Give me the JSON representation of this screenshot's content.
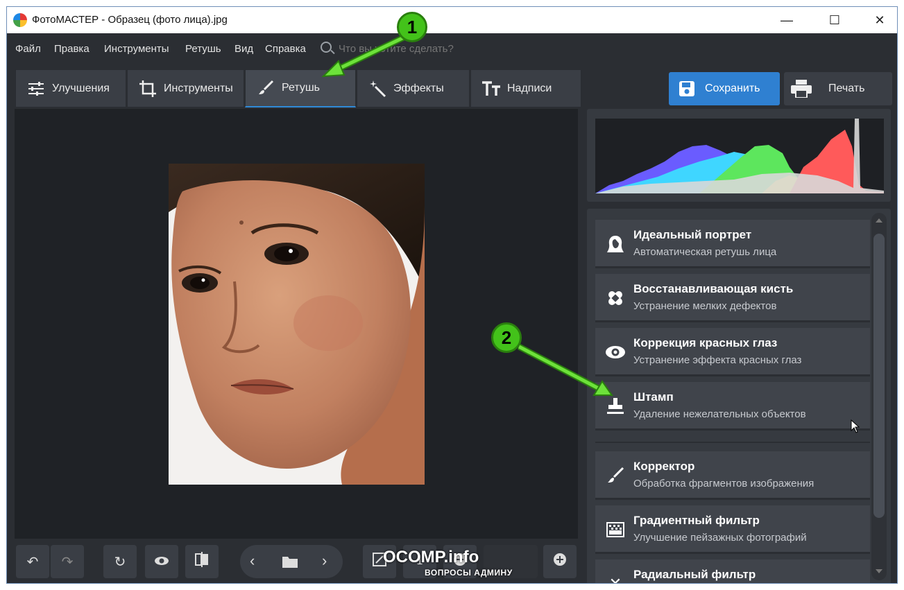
{
  "window": {
    "title": "ФотоМАСТЕР - Образец (фото лица).jpg",
    "minimize": "—",
    "maximize": "☐",
    "close": "✕"
  },
  "menu": {
    "items": [
      "Файл",
      "Правка",
      "Инструменты",
      "Ретушь",
      "Вид",
      "Справка"
    ],
    "search_placeholder": "Что вы хотите сделать?"
  },
  "tabs": [
    {
      "label": "Улучшения",
      "icon": "sliders-icon"
    },
    {
      "label": "Инструменты",
      "icon": "crop-icon"
    },
    {
      "label": "Ретушь",
      "icon": "brush-icon",
      "active": true
    },
    {
      "label": "Эффекты",
      "icon": "magic-wand-icon"
    },
    {
      "label": "Надписи",
      "icon": "text-icon"
    }
  ],
  "toolbar": {
    "save_label": "Сохранить",
    "print_label": "Печать"
  },
  "retouch_tools": [
    {
      "title": "Идеальный портрет",
      "subtitle": "Автоматическая ретушь лица",
      "icon": "portrait-icon"
    },
    {
      "title": "Восстанавливающая кисть",
      "subtitle": "Устранение мелких дефектов",
      "icon": "bandage-icon"
    },
    {
      "title": "Коррекция красных глаз",
      "subtitle": "Устранение эффекта красных глаз",
      "icon": "eye-icon"
    },
    {
      "title": "Штамп",
      "subtitle": "Удаление нежелательных объектов",
      "icon": "stamp-icon"
    },
    {
      "title": "Корректор",
      "subtitle": "Обработка фрагментов изображения",
      "icon": "brush-icon"
    },
    {
      "title": "Градиентный фильтр",
      "subtitle": "Улучшение пейзажных фотографий",
      "icon": "gradient-icon"
    },
    {
      "title": "Радиальный фильтр",
      "subtitle": "",
      "icon": "radial-icon"
    }
  ],
  "annotations": {
    "marker1": "1",
    "marker2": "2",
    "color": "#43c21a"
  },
  "bottom": {
    "zoom_partial": "1"
  },
  "watermark": {
    "text": "OCOMP.info",
    "subtitle": "ВОПРОСЫ АДМИНУ"
  },
  "colors": {
    "accent": "#2f80d1",
    "panel": "#2b2e33",
    "card": "#40444b"
  }
}
